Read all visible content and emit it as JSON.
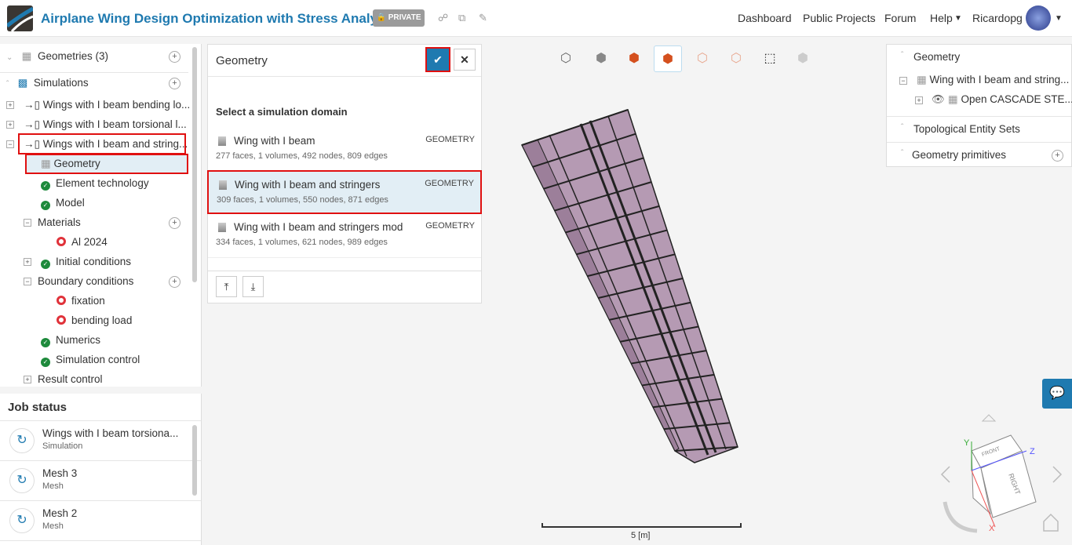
{
  "header": {
    "title": "Airplane Wing Design Optimization with Stress Analysis",
    "privacy": "PRIVATE",
    "nav": [
      "Dashboard",
      "Public Projects",
      "Forum",
      "Help"
    ],
    "user": "Ricardopg"
  },
  "tree": {
    "geometries": "Geometries (3)",
    "simulations": "Simulations",
    "sims": [
      "Wings with I beam bending lo...",
      "Wings with I beam torsional l...",
      "Wings with I beam and string..."
    ],
    "children": {
      "geometry": "Geometry",
      "element": "Element technology",
      "model": "Model",
      "materials": "Materials",
      "al": "Al 2024",
      "initial": "Initial conditions",
      "boundary": "Boundary conditions",
      "fixation": "fixation",
      "bending": "bending load",
      "numerics": "Numerics",
      "simcontrol": "Simulation control",
      "result": "Result control"
    }
  },
  "jobs": {
    "title": "Job status",
    "items": [
      {
        "name": "Wings with I beam torsiona...",
        "type": "Simulation"
      },
      {
        "name": "Mesh 3",
        "type": "Mesh"
      },
      {
        "name": "Mesh 2",
        "type": "Mesh"
      }
    ]
  },
  "geometry_panel": {
    "title": "Geometry",
    "subtitle": "Select a simulation domain",
    "items": [
      {
        "name": "Wing with I beam",
        "tag": "GEOMETRY",
        "desc": "277 faces, 1 volumes, 492 nodes, 809 edges"
      },
      {
        "name": "Wing with I beam and stringers",
        "tag": "GEOMETRY",
        "desc": "309 faces, 1 volumes, 550 nodes, 871 edges"
      },
      {
        "name": "Wing with I beam and stringers mod",
        "tag": "GEOMETRY",
        "desc": "334 faces, 1 volumes, 621 nodes, 989 edges"
      }
    ]
  },
  "right_panel": {
    "geometry": "Geometry",
    "wing": "Wing with I beam and string...",
    "cascade": "Open CASCADE STE...",
    "topo": "Topological Entity Sets",
    "prims": "Geometry primitives"
  },
  "viewer": {
    "scale": "5 [m]",
    "cube_front": "FRONT",
    "cube_right": "RIGHT",
    "axes": [
      "Y",
      "Z",
      "X"
    ]
  }
}
